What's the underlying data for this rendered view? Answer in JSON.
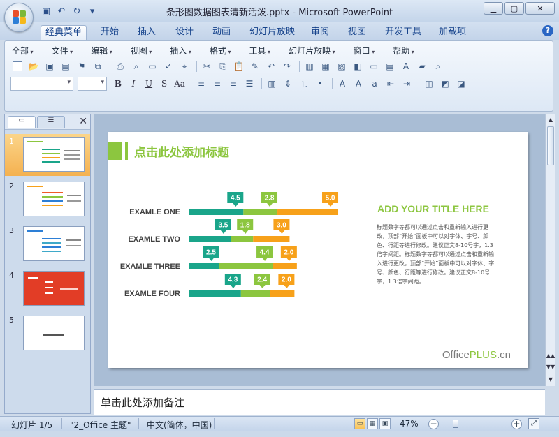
{
  "window": {
    "title": "条形图数据图表清新活泼.pptx - Microsoft PowerPoint"
  },
  "qat": [
    "save-icon",
    "undo-icon",
    "redo-icon",
    "customize-icon"
  ],
  "ribbon_tabs": [
    "经典菜单",
    "开始",
    "插入",
    "设计",
    "动画",
    "幻灯片放映",
    "审阅",
    "视图",
    "开发工具",
    "加载项"
  ],
  "menus": [
    "全部",
    "文件",
    "编辑",
    "视图",
    "插入",
    "格式",
    "工具",
    "幻灯片放映",
    "窗口",
    "帮助"
  ],
  "format_buttons": [
    "B",
    "I",
    "U",
    "S",
    "Aa"
  ],
  "slides_pane": {
    "slide_numbers": [
      "1",
      "2",
      "3",
      "4",
      "5"
    ],
    "selected": 1
  },
  "slide": {
    "title": "点击此处添加标题",
    "right_title": "ADD YOUR TITLE HERE",
    "right_body": "标题数字等都可以通过点击和重新输入进行更改，顶部“开始”面板中可以对字体、字号、颜色、行距等进行修改。建议正文8-10号字，1.3倍字间距。标题数字等都可以通过点击和重新输入进行更改，顶部“开始”面板中可以对字体、字号、颜色、行距等进行修改。建议正文8-10号字，1.3倍字间距。",
    "brand_prefix": "Office",
    "brand_mid": "PLUS",
    "brand_suffix": ".cn"
  },
  "chart_data": {
    "type": "bar",
    "orientation": "horizontal",
    "stacked": true,
    "categories": [
      "EXAMLE ONE",
      "EXAMLE TWO",
      "EXAMLE THREE",
      "EXAMLE FOUR"
    ],
    "series": [
      {
        "values": [
          4.5,
          3.5,
          2.5,
          4.3
        ],
        "color": "#1aa58a"
      },
      {
        "values": [
          2.8,
          1.8,
          4.4,
          2.4
        ],
        "color": "#8cc63f"
      },
      {
        "values": [
          5.0,
          3.0,
          2.0,
          2.0
        ],
        "color": "#f7a11a"
      }
    ]
  },
  "notes": {
    "placeholder": "单击此处添加备注"
  },
  "status": {
    "slide": "幻灯片 1/5",
    "theme": "\"2_Office 主题\"",
    "language": "中文(简体，中国)",
    "zoom": "47%"
  }
}
